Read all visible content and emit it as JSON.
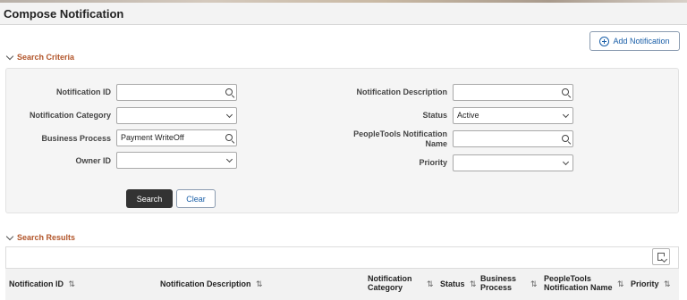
{
  "page": {
    "title": "Compose Notification"
  },
  "toolbar": {
    "add_label": "Add Notification"
  },
  "criteria": {
    "heading": "Search Criteria",
    "notification_id": {
      "label": "Notification ID",
      "value": ""
    },
    "notification_category": {
      "label": "Notification Category",
      "value": ""
    },
    "business_process": {
      "label": "Business Process",
      "value": "Payment WriteOff"
    },
    "owner_id": {
      "label": "Owner ID",
      "value": ""
    },
    "notification_description": {
      "label": "Notification Description",
      "value": ""
    },
    "status": {
      "label": "Status",
      "value": "Active"
    },
    "peopletools_notification_name": {
      "label_line1": "PeopleTools Notification",
      "label_line2": "Name",
      "value": ""
    },
    "priority": {
      "label": "Priority",
      "value": ""
    },
    "search_label": "Search",
    "clear_label": "Clear"
  },
  "results": {
    "heading": "Search Results",
    "sort_glyph": "⇅",
    "columns": [
      {
        "line1": "Notification ID",
        "line2": ""
      },
      {
        "line1": "Notification Description",
        "line2": ""
      },
      {
        "line1": "Notification",
        "line2": "Category"
      },
      {
        "line1": "Status",
        "line2": ""
      },
      {
        "line1": "Business",
        "line2": "Process"
      },
      {
        "line1": "PeopleTools",
        "line2": "Notification Name"
      },
      {
        "line1": "Priority",
        "line2": ""
      }
    ]
  },
  "icons": {
    "add": "plus-circle-icon",
    "lookup": "magnifier-icon",
    "dropdown": "chevron-down-icon",
    "export": "export-icon"
  },
  "colors": {
    "accent": "#b2552a",
    "link": "#1a5fa8",
    "primary_button": "#333333"
  }
}
